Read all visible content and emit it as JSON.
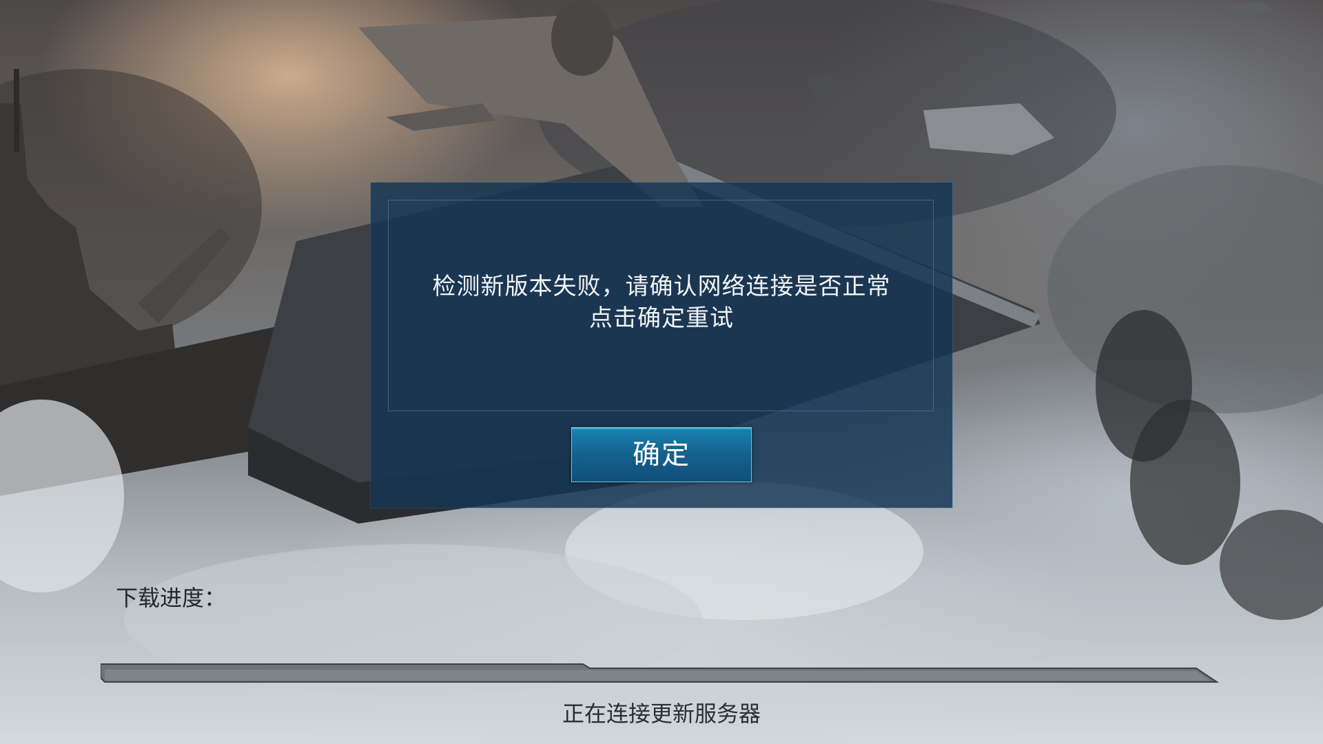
{
  "dialog": {
    "message_line1": "检测新版本失败，请确认网络连接是否正常",
    "message_line2": "点击确定重试",
    "confirm_label": "确定"
  },
  "download": {
    "label": "下载进度：",
    "progress": 0.0,
    "status": "正在连接更新服务器"
  },
  "colors": {
    "dialog_bg": "#143454",
    "button_accent": "#1a82b0",
    "frame_border": "#5fa0cd"
  },
  "icons": [
    "aircraft-carrier-art",
    "fighter-plane-art",
    "battleship-art",
    "smoke-plume-art"
  ]
}
